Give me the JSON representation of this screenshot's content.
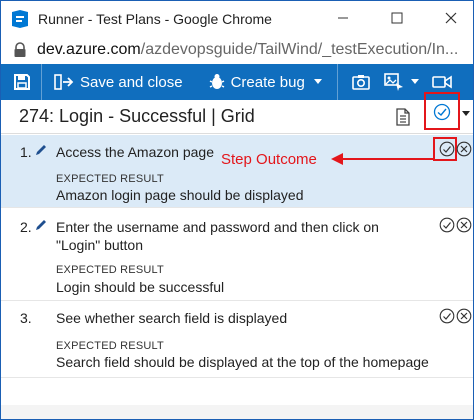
{
  "window": {
    "title": "Runner - Test Plans - Google Chrome",
    "controls": [
      "minimize",
      "maximize",
      "close"
    ]
  },
  "address": {
    "domain": "dev.azure.com",
    "path": "/azdevopsguide/TailWind/_testExecution/In..."
  },
  "toolbar": {
    "save_label": "Save and close",
    "create_bug_label": "Create bug"
  },
  "header": {
    "title": "274: Login - Successful | Grid"
  },
  "annotation": {
    "label": "Step Outcome"
  },
  "steps": [
    {
      "number": "1.",
      "action": "Access the Amazon page",
      "expected_label": "EXPECTED RESULT",
      "expected": "Amazon login page should be displayed"
    },
    {
      "number": "2.",
      "action": "Enter the username and password and then click on \"Login\" button",
      "expected_label": "EXPECTED RESULT",
      "expected": "Login should be successful"
    },
    {
      "number": "3.",
      "action": "See whether search field is displayed",
      "expected_label": "EXPECTED RESULT",
      "expected": "Search field should be displayed at the top of the homepage"
    }
  ],
  "colors": {
    "toolbar": "#106ebe",
    "selected_row": "#dbeaf7",
    "annotation": "#e3161b",
    "accent": "#0078d4"
  }
}
